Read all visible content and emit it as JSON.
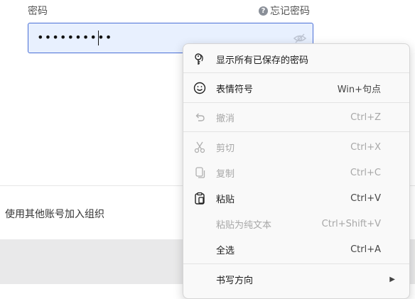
{
  "form": {
    "password_label": "密码",
    "forgot_password": "忘记密码",
    "password_masked": "••••••••••",
    "other_account_link": "使用其他账号加入组织"
  },
  "context_menu": {
    "items": [
      {
        "label": "显示所有已保存的密码",
        "shortcut": "",
        "icon": "key-icon",
        "disabled": false
      },
      {
        "label": "表情符号",
        "shortcut": "Win+句点",
        "icon": "smiley-icon",
        "disabled": false
      },
      {
        "label": "撤消",
        "shortcut": "Ctrl+Z",
        "icon": "undo-icon",
        "disabled": true
      },
      {
        "label": "剪切",
        "shortcut": "Ctrl+X",
        "icon": "scissors-icon",
        "disabled": true
      },
      {
        "label": "复制",
        "shortcut": "Ctrl+C",
        "icon": "copy-icon",
        "disabled": true
      },
      {
        "label": "粘贴",
        "shortcut": "Ctrl+V",
        "icon": "clipboard-icon",
        "disabled": false
      },
      {
        "label": "粘贴为纯文本",
        "shortcut": "Ctrl+Shift+V",
        "icon": "",
        "disabled": true
      },
      {
        "label": "全选",
        "shortcut": "Ctrl+A",
        "icon": "",
        "disabled": false
      },
      {
        "label": "书写方向",
        "shortcut": "",
        "icon": "submenu-arrow-icon",
        "disabled": false
      }
    ]
  },
  "colors": {
    "accent": "#4a6fd6",
    "field_background": "#e8f0fe",
    "disabled_text": "#a7a7a7"
  }
}
